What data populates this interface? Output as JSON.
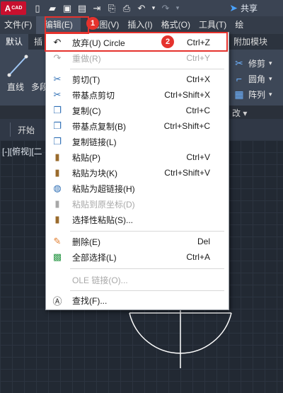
{
  "titlebar": {
    "logo_letter": "A",
    "logo_sub": "CAD",
    "share_label": "共享",
    "icons": [
      "new-file-icon",
      "open-folder-icon",
      "save-icon",
      "save-as-icon",
      "export-icon",
      "import-icon",
      "print-icon",
      "undo-icon",
      "redo-icon",
      "share-icon"
    ]
  },
  "menubar": {
    "items": [
      "文件(F)",
      "编辑(E)",
      "视图(V)",
      "插入(I)",
      "格式(O)",
      "工具(T)",
      "绘"
    ]
  },
  "ribbon": {
    "tabs": [
      "默认",
      "插",
      "附加模块"
    ],
    "tools": {
      "line": "直线",
      "polyline": "多段",
      "modify": "修剪",
      "fillet": "圆角",
      "array": "阵列"
    },
    "sub_label": "改 ▾"
  },
  "doctabs": {
    "start": "开始"
  },
  "viewport": {
    "label": "[-][俯视][二"
  },
  "menu": {
    "items": [
      {
        "icon": "undo-icon",
        "label": "放弃(U) Circle",
        "shortcut": "Ctrl+Z",
        "disabled": false
      },
      {
        "icon": "redo-icon",
        "label": "重做(R)",
        "shortcut": "Ctrl+Y",
        "disabled": true
      },
      {
        "icon": "cut-icon",
        "label": "剪切(T)",
        "shortcut": "Ctrl+X",
        "disabled": false
      },
      {
        "icon": "cut-base-icon",
        "label": "带基点剪切",
        "shortcut": "Ctrl+Shift+X",
        "disabled": false
      },
      {
        "icon": "copy-icon",
        "label": "复制(C)",
        "shortcut": "Ctrl+C",
        "disabled": false
      },
      {
        "icon": "copy-base-icon",
        "label": "带基点复制(B)",
        "shortcut": "Ctrl+Shift+C",
        "disabled": false
      },
      {
        "icon": "copy-link-icon",
        "label": "复制链接(L)",
        "shortcut": "",
        "disabled": false
      },
      {
        "icon": "paste-icon",
        "label": "粘贴(P)",
        "shortcut": "Ctrl+V",
        "disabled": false
      },
      {
        "icon": "paste-block-icon",
        "label": "粘贴为块(K)",
        "shortcut": "Ctrl+Shift+V",
        "disabled": false
      },
      {
        "icon": "paste-hyperlink-icon",
        "label": "粘贴为超链接(H)",
        "shortcut": "",
        "disabled": false
      },
      {
        "icon": "paste-original-icon",
        "label": "粘贴到原坐标(D)",
        "shortcut": "",
        "disabled": true
      },
      {
        "icon": "paste-special-icon",
        "label": "选择性粘贴(S)...",
        "shortcut": "",
        "disabled": false
      },
      {
        "icon": "erase-icon",
        "label": "删除(E)",
        "shortcut": "Del",
        "disabled": false
      },
      {
        "icon": "select-all-icon",
        "label": "全部选择(L)",
        "shortcut": "Ctrl+A",
        "disabled": false
      },
      {
        "icon": "",
        "label": "OLE 链接(O)...",
        "shortcut": "",
        "disabled": true
      },
      {
        "icon": "find-icon",
        "label": "查找(F)...",
        "shortcut": "",
        "disabled": false
      }
    ]
  },
  "annotations": {
    "badge1": "1",
    "badge2": "2",
    "color": "#e5322d"
  }
}
